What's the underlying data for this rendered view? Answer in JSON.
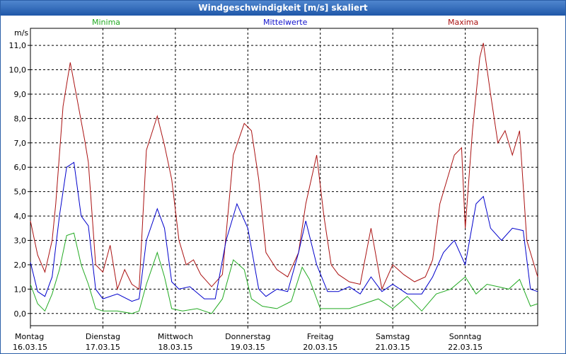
{
  "window": {
    "title": "Windgeschwindigkeit [m/s] skaliert"
  },
  "legend": {
    "min_label": "Minima",
    "mean_label": "Mittelwerte",
    "max_label": "Maxima"
  },
  "colors": {
    "min": "#22aa22",
    "mean": "#0000cc",
    "max": "#aa1111",
    "grid": "#000000",
    "title_bg": "#2d66b5"
  },
  "chart_data": {
    "type": "line",
    "title": "Windgeschwindigkeit [m/s] skaliert",
    "ylabel": "m/s",
    "ylim": [
      -0.5,
      11.7
    ],
    "yticks": [
      "0,0",
      "1,0",
      "2,0",
      "3,0",
      "4,0",
      "5,0",
      "6,0",
      "7,0",
      "8,0",
      "9,0",
      "10,0",
      "11,0"
    ],
    "xlim": [
      0,
      7
    ],
    "xticks": [
      {
        "day": "Montag",
        "date": "16.03.15"
      },
      {
        "day": "Dienstag",
        "date": "17.03.15"
      },
      {
        "day": "Mittwoch",
        "date": "18.03.15"
      },
      {
        "day": "Donnerstag",
        "date": "19.03.15"
      },
      {
        "day": "Freitag",
        "date": "20.03.15"
      },
      {
        "day": "Samstag",
        "date": "21.03.15"
      },
      {
        "day": "Sonntag",
        "date": "22.03.15"
      }
    ],
    "grid": true,
    "series": [
      {
        "name": "Maxima",
        "x": [
          0.0,
          0.1,
          0.2,
          0.3,
          0.35,
          0.45,
          0.55,
          0.65,
          0.75,
          0.8,
          0.9,
          1.0,
          1.1,
          1.2,
          1.3,
          1.4,
          1.5,
          1.6,
          1.75,
          1.85,
          1.95,
          2.05,
          2.15,
          2.25,
          2.35,
          2.5,
          2.65,
          2.8,
          2.95,
          3.05,
          3.15,
          3.25,
          3.4,
          3.55,
          3.7,
          3.8,
          3.95,
          4.05,
          4.15,
          4.25,
          4.4,
          4.55,
          4.7,
          4.85,
          5.0,
          5.15,
          5.3,
          5.45,
          5.55,
          5.65,
          5.75,
          5.85,
          5.95,
          6.0,
          6.1,
          6.2,
          6.25,
          6.35,
          6.45,
          6.55,
          6.65,
          6.75,
          6.85,
          7.0
        ],
        "y": [
          3.8,
          2.4,
          1.7,
          3.0,
          4.5,
          8.5,
          10.3,
          8.7,
          7.1,
          6.2,
          2.0,
          1.7,
          2.8,
          1.0,
          1.8,
          1.2,
          1.0,
          6.7,
          8.1,
          6.9,
          5.5,
          3.0,
          2.0,
          2.2,
          1.6,
          1.1,
          1.6,
          6.5,
          7.8,
          7.5,
          5.5,
          2.5,
          1.8,
          1.5,
          2.5,
          4.5,
          6.5,
          4.0,
          2.0,
          1.6,
          1.3,
          1.2,
          3.5,
          1.0,
          2.0,
          1.6,
          1.3,
          1.5,
          2.2,
          4.5,
          5.5,
          6.5,
          6.8,
          3.5,
          7.5,
          10.5,
          11.1,
          9.0,
          7.0,
          7.5,
          6.5,
          7.5,
          3.0,
          1.5
        ]
      },
      {
        "name": "Mittelwerte",
        "x": [
          0.0,
          0.1,
          0.2,
          0.3,
          0.4,
          0.5,
          0.6,
          0.7,
          0.8,
          0.9,
          1.0,
          1.2,
          1.4,
          1.5,
          1.6,
          1.75,
          1.85,
          1.95,
          2.05,
          2.2,
          2.4,
          2.55,
          2.7,
          2.85,
          3.0,
          3.15,
          3.25,
          3.4,
          3.55,
          3.7,
          3.8,
          3.95,
          4.1,
          4.25,
          4.4,
          4.55,
          4.7,
          4.85,
          5.0,
          5.2,
          5.4,
          5.55,
          5.7,
          5.85,
          6.0,
          6.15,
          6.25,
          6.35,
          6.5,
          6.65,
          6.8,
          6.9,
          7.0
        ],
        "y": [
          2.1,
          0.9,
          0.7,
          1.5,
          4.0,
          6.0,
          6.2,
          4.0,
          3.6,
          1.0,
          0.6,
          0.8,
          0.5,
          0.6,
          3.0,
          4.3,
          3.5,
          1.3,
          1.0,
          1.1,
          0.6,
          0.6,
          3.0,
          4.5,
          3.5,
          1.0,
          0.7,
          1.0,
          0.9,
          2.5,
          3.8,
          2.0,
          0.9,
          0.9,
          1.1,
          0.8,
          1.5,
          0.9,
          1.2,
          0.8,
          0.8,
          1.5,
          2.5,
          3.0,
          2.0,
          4.5,
          4.8,
          3.5,
          3.0,
          3.5,
          3.4,
          1.0,
          0.9
        ]
      },
      {
        "name": "Minima",
        "x": [
          0.0,
          0.1,
          0.2,
          0.3,
          0.4,
          0.5,
          0.6,
          0.7,
          0.8,
          0.9,
          1.0,
          1.2,
          1.4,
          1.5,
          1.6,
          1.75,
          1.85,
          1.95,
          2.1,
          2.3,
          2.5,
          2.65,
          2.8,
          2.95,
          3.05,
          3.2,
          3.4,
          3.6,
          3.75,
          3.85,
          4.0,
          4.2,
          4.4,
          4.6,
          4.8,
          5.0,
          5.2,
          5.4,
          5.6,
          5.8,
          6.0,
          6.15,
          6.3,
          6.45,
          6.6,
          6.75,
          6.9,
          7.0
        ],
        "y": [
          1.2,
          0.4,
          0.1,
          0.8,
          1.8,
          3.2,
          3.3,
          2.0,
          1.2,
          0.2,
          0.1,
          0.1,
          0.0,
          0.1,
          1.2,
          2.5,
          1.5,
          0.2,
          0.1,
          0.2,
          0.0,
          0.6,
          2.2,
          1.8,
          0.6,
          0.3,
          0.2,
          0.5,
          1.9,
          1.4,
          0.2,
          0.2,
          0.2,
          0.4,
          0.6,
          0.2,
          0.7,
          0.1,
          0.8,
          1.0,
          1.5,
          0.8,
          1.2,
          1.1,
          1.0,
          1.4,
          0.3,
          0.4
        ]
      }
    ]
  }
}
